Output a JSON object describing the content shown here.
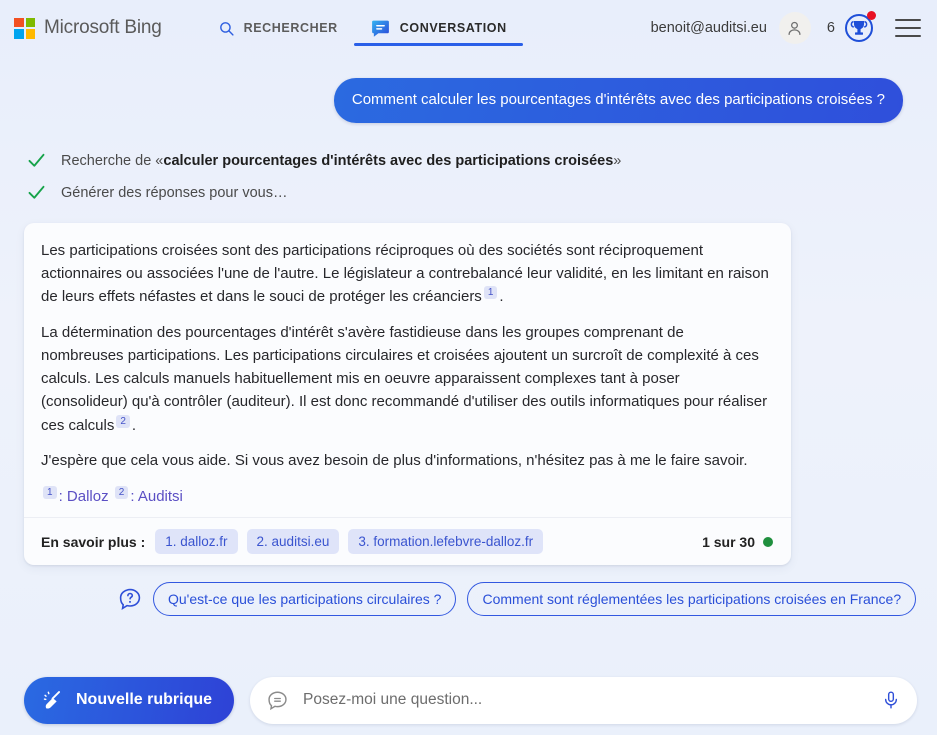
{
  "header": {
    "brand": "Microsoft Bing",
    "logo_colors": [
      "#f25022",
      "#7fba00",
      "#00a4ef",
      "#ffb900"
    ],
    "tabs": [
      {
        "label": "RECHERCHER",
        "icon": "search-icon",
        "active": false
      },
      {
        "label": "CONVERSATION",
        "icon": "chat-bubble-icon",
        "active": true
      }
    ],
    "account_email": "benoit@auditsi.eu",
    "avatar_icon": "person-icon",
    "rewards_count": "6",
    "rewards_icon": "trophy-icon",
    "menu_icon": "hamburger-icon",
    "accent": "#2a5fe8"
  },
  "conversation": {
    "user_question": "Comment calculer les pourcentages d'intérêts avec des participations croisées ?",
    "status_steps": [
      {
        "icon": "check-icon",
        "prefix": "Recherche de «",
        "bold": "calculer pourcentages d'intérêts avec des participations croisées",
        "suffix": "»"
      },
      {
        "icon": "check-icon",
        "prefix": "Générer des réponses pour vous…",
        "bold": "",
        "suffix": ""
      }
    ],
    "answer": {
      "paragraph_1_a": "Les participations croisées sont des participations réciproques où des sociétés sont réciproquement actionnaires ou associées l'une de l'autre. Le législateur a contrebalancé leur validité, en les limitant en raison de leurs effets néfastes et dans le souci de protéger les créanciers",
      "paragraph_1_cite": "1",
      "paragraph_1_b": ".",
      "paragraph_2_a": "La détermination des pourcentages d'intérêt s'avère fastidieuse dans les groupes comprenant de nombreuses participations. Les participations circulaires et croisées ajoutent un surcroît de complexité à ces calculs. Les calculs manuels habituellement mis en oeuvre apparaissent complexes tant à poser (consolideur) qu'à contrôler (auditeur). Il est donc recommandé d'utiliser des outils informatiques pour réaliser ces calculs",
      "paragraph_2_cite": "2",
      "paragraph_2_b": ".",
      "paragraph_3": "J'espère que cela vous aide. Si vous avez besoin de plus d'informations, n'hésitez pas à me le faire savoir.",
      "footnotes": [
        {
          "marker": "1",
          "separator": ": ",
          "name": "Dalloz"
        },
        {
          "marker": "2",
          "separator": ": ",
          "name": "Auditsi"
        }
      ]
    },
    "footer": {
      "more_label": "En savoir plus :",
      "source_chips": [
        "1. dalloz.fr",
        "2. auditsi.eu",
        "3. formation.lefebvre-dalloz.fr"
      ],
      "counter": "1 sur 30",
      "counter_dot_color": "#1f8f3e"
    },
    "suggestions": {
      "icon": "question-bubble-icon",
      "items": [
        "Qu'est-ce que les participations circulaires ?",
        "Comment sont réglementées les participations croisées en France?"
      ]
    }
  },
  "composer": {
    "new_topic_label": "Nouvelle rubrique",
    "new_topic_icon": "broom-icon",
    "input_icon": "chat-bubble-outline-icon",
    "input_value": "",
    "input_placeholder": "Posez-moi une question...",
    "mic_icon": "microphone-icon"
  }
}
